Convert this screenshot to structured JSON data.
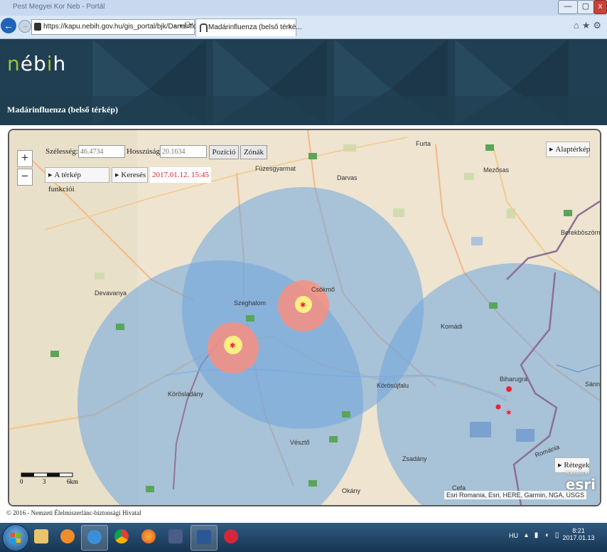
{
  "browser": {
    "window_title": "Pest Megyei Kor Neb - Portál",
    "url": "https://kapu.nebih.gov.hu/gis_portal/bjk/DanaInfo",
    "tab_title": "Madárinfluenza (belső térké...",
    "tab_close": "×",
    "window_buttons": [
      "—",
      "▢",
      "x"
    ],
    "tools": [
      "home-icon",
      "star-icon",
      "gear-icon"
    ]
  },
  "header": {
    "logo_text": [
      "n",
      "é",
      "b",
      "i",
      "h"
    ],
    "app_title": "Madárinfluenza (belső térkép)",
    "brand_color": "#203f52",
    "logo_accent": "#9cc33b"
  },
  "map": {
    "zoom_in": "+",
    "zoom_out": "−",
    "lat_label": "Szélesség:",
    "lat_value": "46.4734",
    "lon_label": "Hosszúság:",
    "lon_value": "20.1634",
    "position_button": "Pozíció",
    "zones_button": "Zónák",
    "functions_button": "A térkép funkciói",
    "search_button": "Keresés",
    "date": "2017.01.12. 15:45",
    "date_color": "#d2232a",
    "basemap_button": "Alaptérkép",
    "layers_button": "Rétegek",
    "attribution": "Esri Romania, Esri, HERE, Garmin, NGA, USGS",
    "esri_powered": "POWERED BY",
    "esri_logo": "esri",
    "scale_labels": [
      "0",
      "3",
      "6km"
    ],
    "places": [
      "Furta",
      "Füzesgyarmat",
      "Darvas",
      "Mezősas",
      "Berekböszörmény",
      "Devavanya",
      "Szeghalom",
      "Csökmő",
      "Komádi",
      "Körösladány",
      "Körösújfalu",
      "Biharugra",
      "Sánni",
      "Vésztő",
      "Zsadány",
      "Okány",
      "Cefa",
      "Románia"
    ],
    "zone_colors": {
      "surveillance": "#6fa5df",
      "protection": "#ff8c7a",
      "core": "#ffef82",
      "outbreak": "#e8262e"
    }
  },
  "footer": {
    "copyright": "© 2016 - Nemzeti Élelmiszerlánc-biztonsági Hivatal"
  },
  "taskbar": {
    "apps": [
      "explorer-icon",
      "media-player-icon",
      "internet-explorer-icon",
      "chrome-icon",
      "firefox-icon",
      "save-icon",
      "word-icon",
      "mail-icon"
    ],
    "language": "HU",
    "time": "8:21",
    "date": "2017.01.13"
  }
}
